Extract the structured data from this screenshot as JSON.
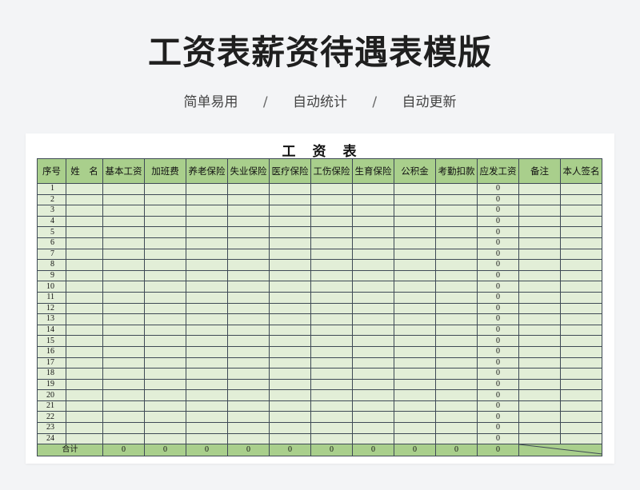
{
  "page": {
    "title": "工资表薪资待遇表模版",
    "subtitle_items": [
      "简单易用",
      "自动统计",
      "自动更新"
    ],
    "separator": "/"
  },
  "sheet": {
    "title": "工　资　表",
    "headers": [
      "序号",
      "姓　名",
      "基本工资",
      "加班费",
      "养老保险",
      "失业保险",
      "医疗保险",
      "工伤保险",
      "生育保险",
      "公积金",
      "考勤扣款",
      "应发工资",
      "备注",
      "本人签名"
    ],
    "row_numbers": [
      "1",
      "2",
      "3",
      "4",
      "5",
      "6",
      "7",
      "8",
      "9",
      "10",
      "11",
      "12",
      "13",
      "14",
      "15",
      "16",
      "17",
      "18",
      "19",
      "20",
      "21",
      "22",
      "23",
      "24"
    ],
    "payable_values": [
      "0",
      "0",
      "0",
      "0",
      "0",
      "0",
      "0",
      "0",
      "0",
      "0",
      "0",
      "0",
      "0",
      "0",
      "0",
      "0",
      "0",
      "0",
      "0",
      "0",
      "0",
      "0",
      "0",
      "0"
    ],
    "total_label": "合计",
    "total_values": [
      "0",
      "0",
      "0",
      "0",
      "0",
      "0",
      "0",
      "0",
      "0",
      "0"
    ],
    "colors": {
      "header_bg": "#a9cf8c",
      "cell_bg": "#e2eed7",
      "border": "#3f4a56"
    }
  }
}
